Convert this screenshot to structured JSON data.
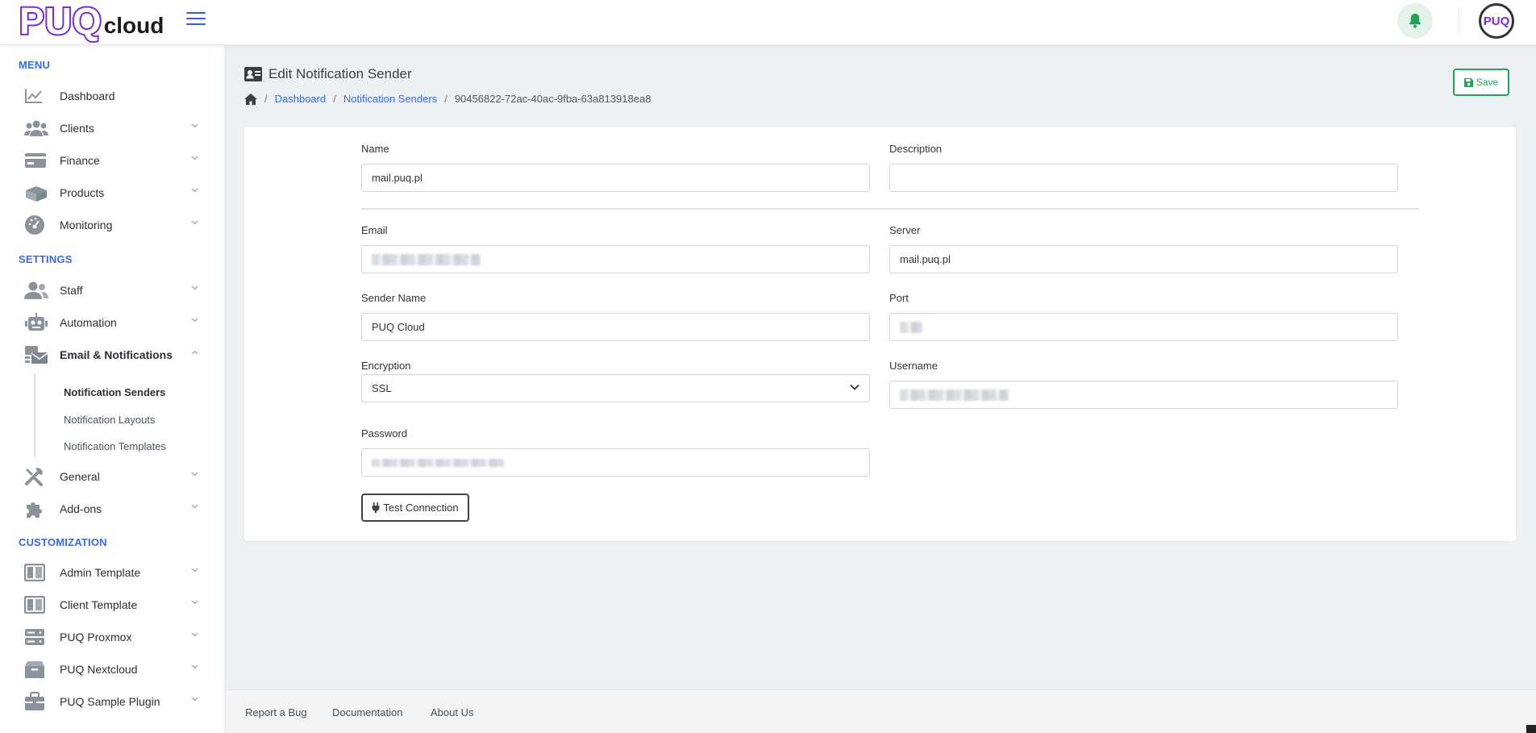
{
  "brand": {
    "logo_main": "PUQ",
    "logo_sub": "cloud"
  },
  "header": {
    "avatar_text": "PUQ"
  },
  "sidebar": {
    "sections": [
      {
        "title": "MENU"
      },
      {
        "title": "SETTINGS"
      },
      {
        "title": "CUSTOMIZATION"
      }
    ],
    "items": [
      {
        "label": "Dashboard",
        "icon": "chart-line-icon"
      },
      {
        "label": "Clients",
        "icon": "users-icon"
      },
      {
        "label": "Finance",
        "icon": "credit-card-icon"
      },
      {
        "label": "Products",
        "icon": "boxes-icon"
      },
      {
        "label": "Monitoring",
        "icon": "gauge-icon"
      },
      {
        "label": "Staff",
        "icon": "user-group-icon"
      },
      {
        "label": "Automation",
        "icon": "robot-icon"
      },
      {
        "label": "Email & Notifications",
        "icon": "mail-bulk-icon"
      },
      {
        "label": "General",
        "icon": "tools-icon"
      },
      {
        "label": "Add-ons",
        "icon": "puzzle-icon"
      },
      {
        "label": "Admin Template",
        "icon": "layout-icon"
      },
      {
        "label": "Client Template",
        "icon": "layout-icon"
      },
      {
        "label": "PUQ Proxmox",
        "icon": "server-icon"
      },
      {
        "label": "PUQ Nextcloud",
        "icon": "box-icon"
      },
      {
        "label": "PUQ Sample Plugin",
        "icon": "briefcase-icon"
      }
    ],
    "submenu": [
      {
        "label": "Notification Senders",
        "active": true
      },
      {
        "label": "Notification Layouts",
        "active": false
      },
      {
        "label": "Notification Templates",
        "active": false
      }
    ]
  },
  "page": {
    "title": "Edit Notification Sender",
    "breadcrumb": [
      "Dashboard",
      "Notification Senders",
      "90456822-72ac-40ac-9fba-63a813918ea8"
    ],
    "save_label": "Save"
  },
  "form": {
    "name_label": "Name",
    "name_value": "mail.puq.pl",
    "description_label": "Description",
    "description_value": "",
    "email_label": "Email",
    "server_label": "Server",
    "server_value": "mail.puq.pl",
    "sender_name_label": "Sender Name",
    "sender_name_value": "PUQ Cloud",
    "port_label": "Port",
    "encryption_label": "Encryption",
    "encryption_value": "SSL",
    "username_label": "Username",
    "password_label": "Password",
    "test_connection_label": "Test Connection"
  },
  "footer": {
    "links": [
      "Report a Bug",
      "Documentation",
      "About Us"
    ]
  },
  "colors": {
    "accent": "#3a6bd9",
    "brand": "#7b2ccf",
    "success": "#28a25a"
  }
}
